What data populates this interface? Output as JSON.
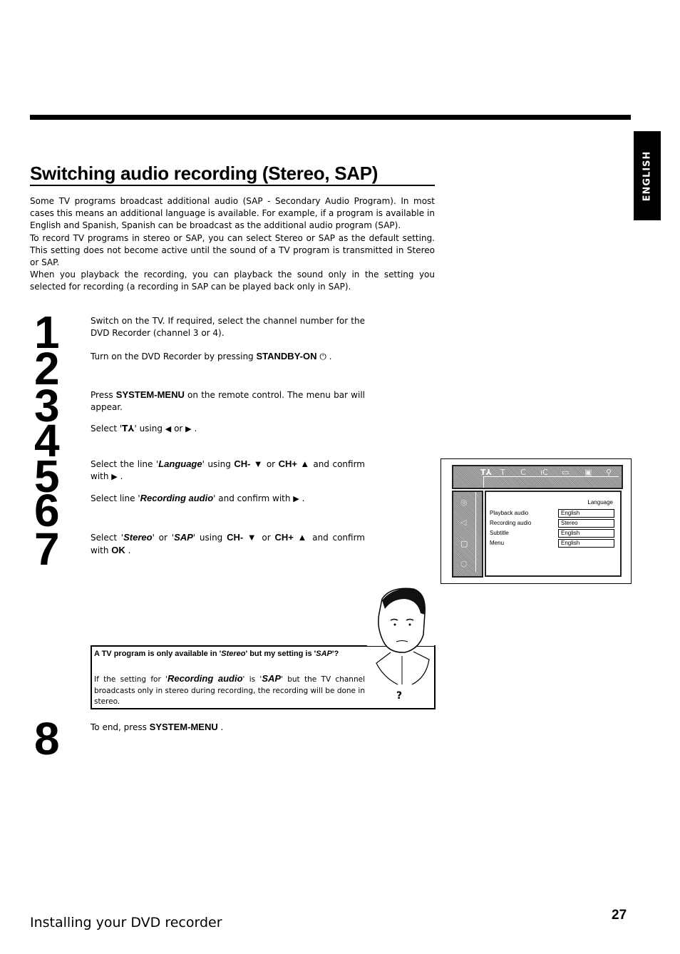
{
  "side_tab": "ENGLISH",
  "title": "Switching audio recording (Stereo, SAP)",
  "intro": [
    "Some TV programs broadcast additional audio (SAP - Secondary Audio Program). In most cases this means an additional language is available. For example, if a program is available in English and Spanish, Spanish can be broadcast as the additional audio program (SAP).",
    "To record TV programs in stereo or SAP, you can select Stereo or SAP as the default setting. This setting does not become active until the sound of a TV program is transmitted in Stereo or SAP.",
    "When you playback the recording, you can playback the sound only in the setting you selected for recording (a recording in SAP can be played back only in SAP)."
  ],
  "step_numbers": [
    "1",
    "2",
    "3",
    "4",
    "5",
    "6",
    "7",
    "8"
  ],
  "steps": {
    "s1": "Switch on the TV. If required, select the channel number for the DVD Recorder (channel 3 or 4).",
    "s2_pre": "Turn on the DVD Recorder by pressing ",
    "s2_key": "STANDBY-ON",
    "s2_icon": "⏻",
    "s3_pre": "Press ",
    "s3_key": "SYSTEM-MENU",
    "s3_post": " on the remote control. The menu bar will appear.",
    "s4_pre": "Select '",
    "s4_icon": "T⅄",
    "s4_mid": "' using ",
    "s4_left": "◀",
    "s4_or": " or ",
    "s4_right": "▶",
    "s5_pre": "Select the line '",
    "s5_item": "Language",
    "s5_mid": "' using ",
    "s5_key1": "CH- ▼",
    "s5_or": " or ",
    "s5_key2": "CH+ ▲",
    "s5_post": " and confirm with ",
    "s5_arrow": "▶",
    "s6_pre": "Select line '",
    "s6_item": "Recording audio",
    "s6_post": "' and confirm with ",
    "s6_arrow": "▶",
    "s7_pre": "Select '",
    "s7_item1": "Stereo",
    "s7_mid1": "' or '",
    "s7_item2": "SAP",
    "s7_mid2": "' using ",
    "s7_key1": "CH- ▼",
    "s7_or": " or ",
    "s7_key2": "CH+ ▲",
    "s7_post": " and confirm with ",
    "s7_key3": "OK",
    "s8_pre": "To end, press ",
    "s8_key": "SYSTEM-MENU"
  },
  "screen": {
    "header": "Language",
    "rows": [
      {
        "label": "Playback audio",
        "value": "English"
      },
      {
        "label": "Recording audio",
        "value": "Stereo"
      },
      {
        "label": "Subtitle",
        "value": "English"
      },
      {
        "label": "Menu",
        "value": "English"
      }
    ]
  },
  "tip": {
    "q_pre": "A TV program is only available in '",
    "q_item1": "Stereo",
    "q_mid": "' but my setting is '",
    "q_item2": "SAP",
    "q_post": "'?",
    "a_pre": "If the setting for '",
    "a_item1": "Recording audio",
    "a_mid": "' is '",
    "a_item2": "SAP",
    "a_post": "' but the TV channel broadcasts only in stereo during recording, the recording will be done in stereo.",
    "mark": "?"
  },
  "footer": {
    "section": "Installing your DVD recorder",
    "page": "27"
  }
}
